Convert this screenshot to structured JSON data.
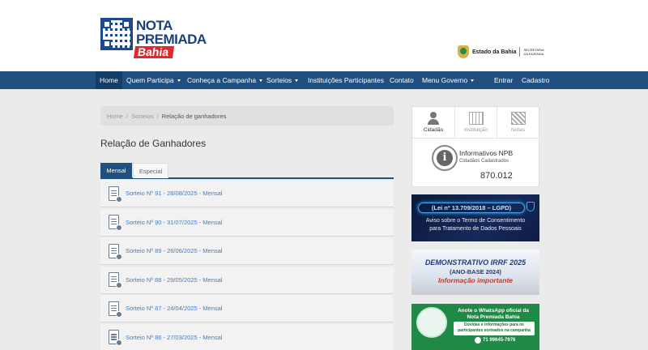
{
  "header": {
    "logo": {
      "line1": "NOTA",
      "line2": "PREMIADA",
      "line3": "Bahia"
    },
    "gov_name": "Estado da Bahia",
    "gov_secretariat": "SECRETARIA DA FAZENDA"
  },
  "nav": {
    "items": [
      {
        "label": "Home"
      },
      {
        "label": "Quem Participa"
      },
      {
        "label": "Conheça a Campanha"
      },
      {
        "label": "Sorteios"
      },
      {
        "label": "Instituições Participantes"
      },
      {
        "label": "Contato"
      },
      {
        "label": "Menu Governo"
      },
      {
        "label": "Entrar"
      },
      {
        "label": "Cadastro"
      }
    ]
  },
  "breadcrumb": {
    "home": "Home",
    "section": "Sorteios",
    "current": "Relação de ganhadores"
  },
  "page_title": "Relação de Ganhadores",
  "tabs": {
    "active": "Mensal",
    "inactive": "Especial"
  },
  "draws": [
    {
      "label": "Sorteio Nº 91 - 28/08/2025 - Mensal"
    },
    {
      "label": "Sorteio Nº 90 - 31/07/2025 - Mensal"
    },
    {
      "label": "Sorteio Nº 89 - 26/06/2025 - Mensal"
    },
    {
      "label": "Sorteio Nº 88 - 29/05/2025 - Mensal"
    },
    {
      "label": "Sorteio Nº 87 - 24/04/2025 - Mensal"
    },
    {
      "label": "Sorteio Nº 86 - 27/03/2025 - Mensal"
    }
  ],
  "profile_tabs": {
    "citizen": "Cidadão",
    "institution": "Instituição",
    "notes": "Notas"
  },
  "info": {
    "title": "Informativos NPB",
    "subtitle": "Cidadãos Cadastrados",
    "count": "870.012"
  },
  "banners": {
    "lgpd": {
      "title": "(Lei nº 13.709/2018 – LGPD)",
      "line2": "Aviso sobre o Termo de Consentimento",
      "line3": "para Tratamento de Dados Pessoais"
    },
    "irrf": {
      "line1": "DEMONSTRATIVO IRRF 2025",
      "line2": "(ANO-BASE 2024)",
      "line3": "Informação importante"
    },
    "whatsapp": {
      "line1": "Anote o WhatsApp oficial da",
      "line2": "Nota Premiada Bahia",
      "box": "Dúvidas e informações para os participantes sorteados na campanha",
      "phone": "71 99645-7976"
    }
  },
  "colors": {
    "navbar": "#1f5080",
    "active": "#153e66",
    "link": "#4a7db5",
    "brand_red": "#e3262b"
  }
}
